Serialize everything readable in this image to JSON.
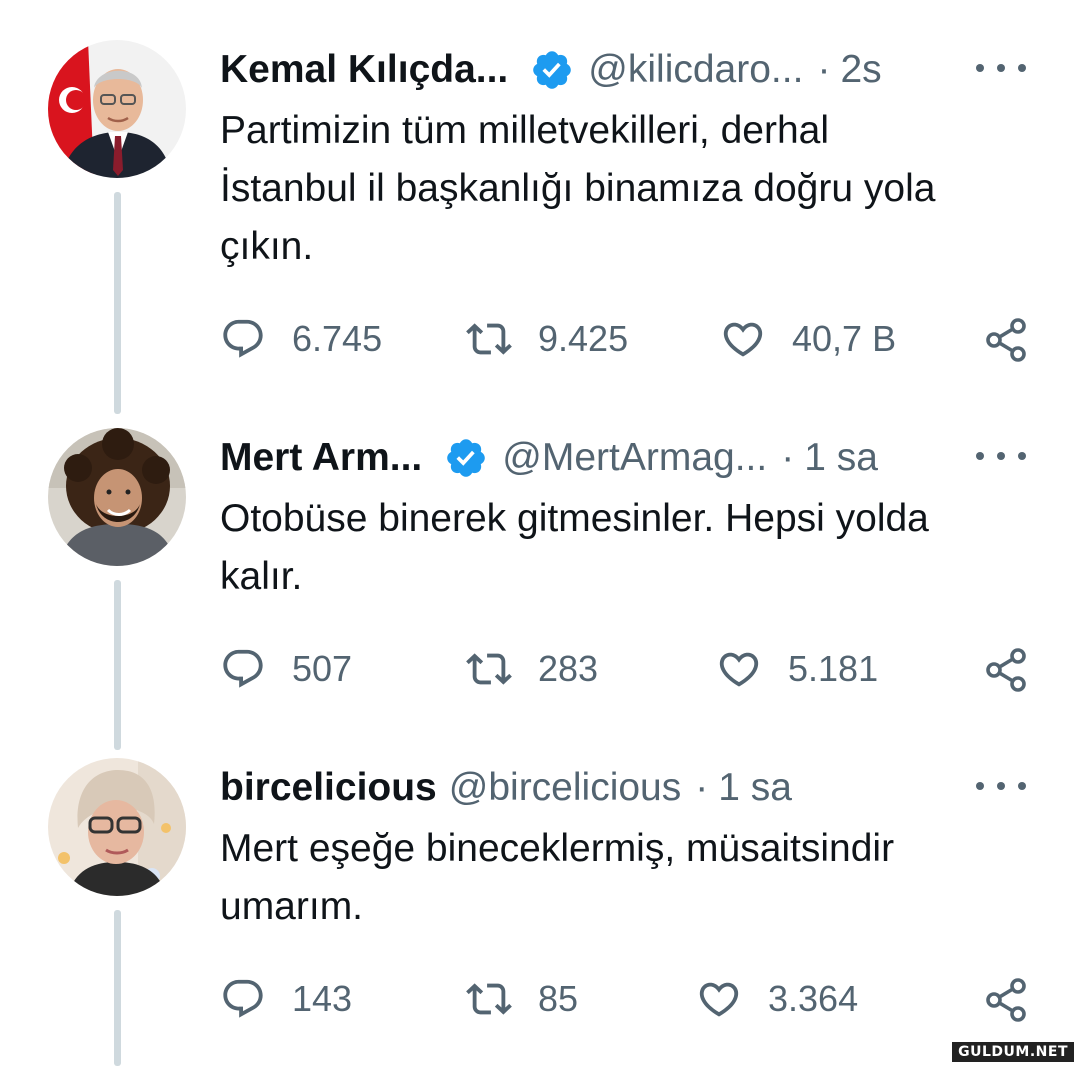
{
  "tweets": [
    {
      "name": "Kemal Kılıçda...",
      "handle": "@kilicdaro...",
      "time": "2s",
      "text_lines": [
        "Partimizin tüm milletvekilleri, derhal",
        "İstanbul il başkanlığı binamıza doğru yola",
        "çıkın."
      ],
      "replies": "6.745",
      "retweets": "9.425",
      "likes": "40,7 B",
      "verified": true
    },
    {
      "name": "Mert Arm...",
      "handle": "@MertArmag...",
      "time": "1 sa",
      "text_lines": [
        "Otobüse binerek gitmesinler. Hepsi yolda",
        "kalır."
      ],
      "replies": "507",
      "retweets": "283",
      "likes": "5.181",
      "verified": true
    },
    {
      "name": "bircelicious",
      "handle": "@bircelicious",
      "time": "1 sa",
      "text_lines": [
        "Mert eşeğe bineceklermiş, müsaitsindir",
        "umarım."
      ],
      "replies": "143",
      "retweets": "85",
      "likes": "3.364",
      "verified": false
    }
  ],
  "separator": "·",
  "watermark": "GULDUM.NET",
  "colors": {
    "verified": "#1d9bf0",
    "muted": "#536471",
    "text": "#0f1419",
    "thread_line": "#cfd9de"
  }
}
